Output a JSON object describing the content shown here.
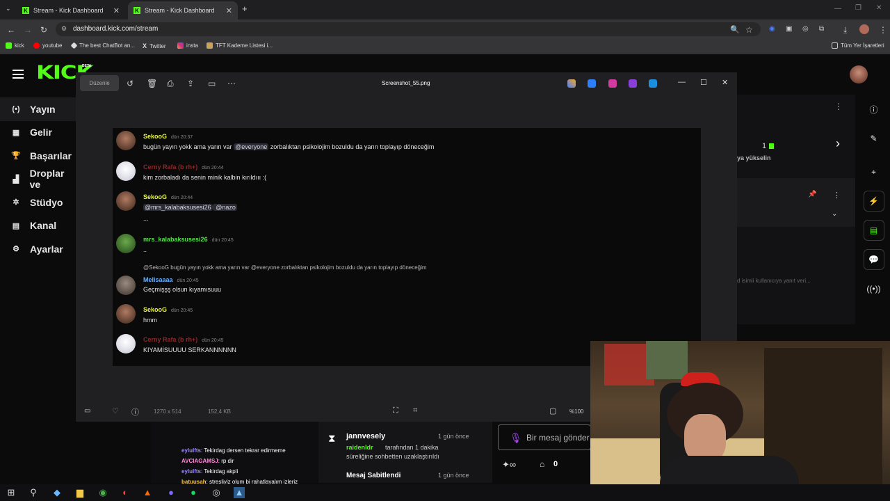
{
  "browser": {
    "tabs": [
      {
        "title": "Stream - Kick Dashboard"
      },
      {
        "title": "Stream - Kick Dashboard"
      }
    ],
    "url": "dashboard.kick.com/stream",
    "bookmarks": [
      "kick",
      "youtube",
      "The best ChatBot an...",
      "Twitter",
      "insta",
      "TFT Kademe Listesi i..."
    ],
    "other_bookmarks": "Tüm Yer İşaretleri"
  },
  "kick": {
    "logo": "KICK",
    "badge": "BETA",
    "nav": [
      "Yayın",
      "Gelir",
      "Başarılar",
      "Droplar ve",
      "Stüdyo",
      "Kanal",
      "Ayarlar"
    ],
    "bg_count": "1",
    "bg_promote": "ya yükselin",
    "bg_reply_hint": "d isimli kullanıcıya yanıt veri..."
  },
  "viewer": {
    "edit_label": "Düzenle",
    "filename": "Screenshot_55.png",
    "dimensions": "1270 x 514",
    "filesize": "152,4 KB",
    "zoom": "%100",
    "messages": [
      {
        "user": "SekooG",
        "time": "dün 20:37",
        "color": "#e6f542",
        "avatar": "s",
        "pre": "bugün yayın yokk ama yarın var ",
        "mention": "@everyone",
        "post": " zorbalıktan psikolojim bozuldu da yarın toplayıp döneceğim"
      },
      {
        "user": "Cerny Rafa (b rh+)",
        "time": "dün 20:44",
        "color": "#8a2a2a",
        "avatar": "c",
        "pre": "kim zorbaladı da senin minik kalbin kırıldııı :(",
        "mention": "",
        "post": ""
      },
      {
        "user": "SekooG",
        "time": "dün 20:44",
        "color": "#e6f542",
        "avatar": "s",
        "pre": "",
        "mention": "@mrs_kalabaksusesi26",
        "post": " @nazo",
        "extra": "..."
      },
      {
        "user": "mrs_kalabaksusesi26",
        "time": "dün 20:45",
        "color": "#53e04a",
        "avatar": "m",
        "pre": "..",
        "mention": "",
        "post": ""
      },
      {
        "user": "Melisaaaa",
        "time": "dün 20:45",
        "color": "#6ab0ff",
        "avatar": "me",
        "reply": "@SekooG bugün yayın yokk ama yarın var @everyone zorbalıktan psikolojim bozuldu da yarın toplayıp döneceğim",
        "pre": "Geçmişşş olsun kıyamısuuu",
        "mention": "",
        "post": ""
      },
      {
        "user": "SekooG",
        "time": "dün 20:45",
        "color": "#e6f542",
        "avatar": "s",
        "pre": "hmm",
        "mention": "",
        "post": ""
      },
      {
        "user": "Cerny Rafa (b rh+)",
        "time": "dün 20:45",
        "color": "#8a2a2a",
        "avatar": "c",
        "pre": "KIYAMİSUUUU SERKANNNNNN",
        "mention": "",
        "post": ""
      }
    ]
  },
  "chat": [
    {
      "user": "eylulfts",
      "text": ": Tekirdag dersen tekrar edirmeme"
    },
    {
      "user": "AVCIAGAMSJ",
      "text": ": rp dir"
    },
    {
      "user": "eylulfts",
      "text": ": Tekirdag akpli"
    },
    {
      "user": "batuusah",
      "text": ": stresliyiz olum bi rahatlayalım izleriz"
    }
  ],
  "mod": {
    "user": "jannvesely",
    "time": "1 gün önce",
    "actor": "raidenldr",
    "text1": "tarafından 1 dakika",
    "text2": "süreliğine sohbetten uzaklaştırıldı",
    "pinned": "Mesaj Sabitlendi",
    "pinned_time": "1 gün önce"
  },
  "composer": {
    "placeholder": "Bir mesaj gönder",
    "count": "0"
  }
}
